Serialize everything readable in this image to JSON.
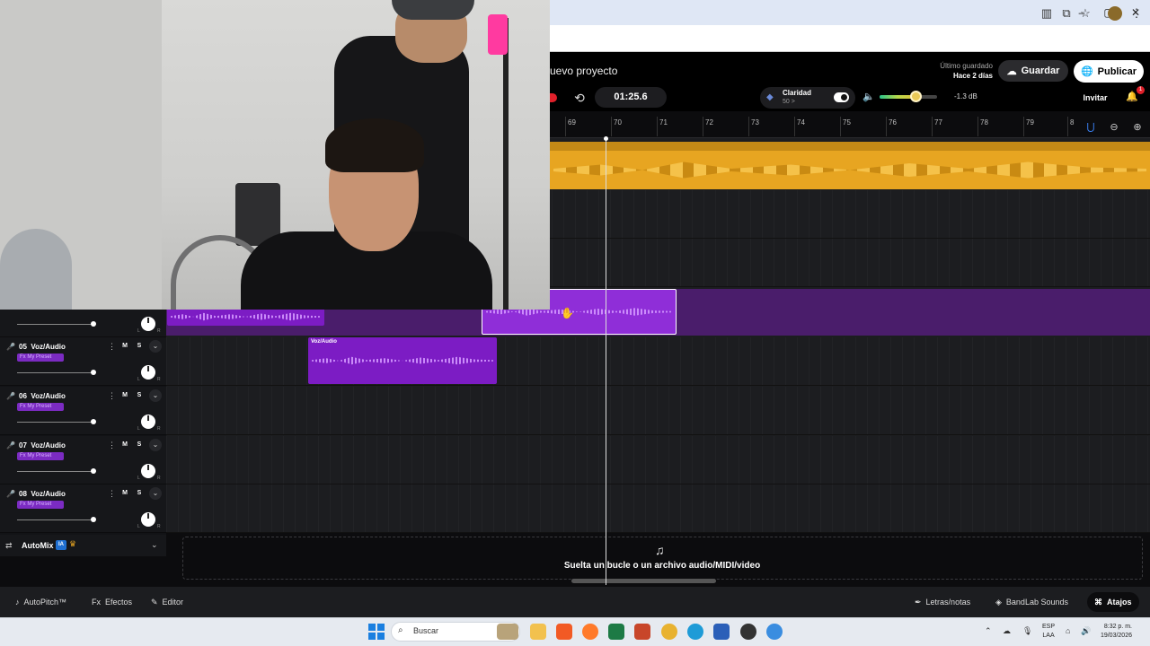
{
  "window": {
    "minimize": "–",
    "maximize": "▢",
    "close": "✕"
  },
  "header": {
    "project_title": "uevo proyecto",
    "last_saved_label": "Último guardado",
    "last_saved_value": "Hace 2 días",
    "save_label": "Guardar",
    "publish_label": "Publicar"
  },
  "transport": {
    "time": "01:25.6",
    "clarity_label": "Claridad",
    "clarity_value": "50 >",
    "volume_db": "-1.3 dB",
    "volume_level": 0.62,
    "invite_label": "Invitar",
    "notification_count": "1"
  },
  "ruler": {
    "ticks": [
      "69",
      "70",
      "71",
      "72",
      "73",
      "74",
      "75",
      "76",
      "77",
      "78",
      "79",
      "8"
    ]
  },
  "tracks": [
    {
      "number": "05",
      "name": "Voz/Audio",
      "m": "M",
      "s": "S",
      "fx": "Fx My Preset",
      "pan_l": "L",
      "pan_r": "R"
    },
    {
      "number": "06",
      "name": "Voz/Audio",
      "m": "M",
      "s": "S",
      "fx": "Fx My Preset",
      "pan_l": "L",
      "pan_r": "R"
    },
    {
      "number": "07",
      "name": "Voz/Audio",
      "m": "M",
      "s": "S",
      "fx": "Fx My Preset",
      "pan_l": "L",
      "pan_r": "R"
    },
    {
      "number": "08",
      "name": "Voz/Audio",
      "m": "M",
      "s": "S",
      "fx": "Fx My Preset",
      "pan_l": "L",
      "pan_r": "R"
    }
  ],
  "partial_track": {
    "pan_l": "L",
    "pan_r": "R"
  },
  "clips": {
    "track05_clip_label": "Voz/Audio"
  },
  "automix": {
    "label": "AutoMix",
    "badge": "IA"
  },
  "dropzone": {
    "text": "Suelta un bucle o un archivo audio/MIDI/video"
  },
  "bottom_bar": {
    "autopitch": "AutoPitch™",
    "effects": "Efectos",
    "editor": "Editor",
    "lyrics": "Letras/notas",
    "sounds": "BandLab Sounds",
    "shortcuts": "Atajos"
  },
  "taskbar": {
    "search_placeholder": "Buscar",
    "lang_1": "ESP",
    "lang_2": "LAA",
    "time": "8:32 p. m.",
    "date": "19/03/2026"
  },
  "colors": {
    "accent_purple": "#7c1cc4",
    "loop_yellow": "#e7a521",
    "record_red": "#e0202a"
  }
}
